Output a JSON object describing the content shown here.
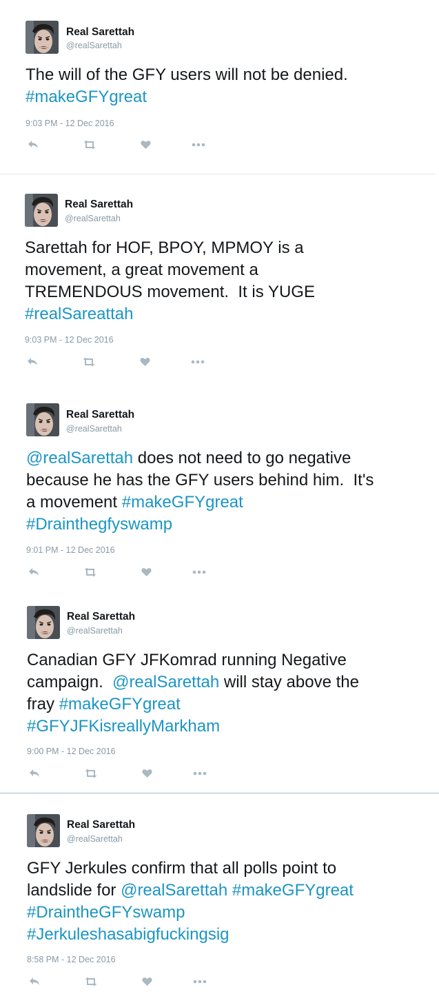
{
  "colors": {
    "link": "#1b95c4",
    "muted": "#8899a6",
    "text": "#14171a",
    "divider": "#e1e8ed"
  },
  "icons": [
    "reply-icon",
    "retweet-icon",
    "like-icon",
    "more-icon"
  ],
  "tweets": [
    {
      "name": "Real Sarettah",
      "handle": "@realSarettah",
      "lines": [
        [
          {
            "t": "The will of the GFY users will not be denied.",
            "link": false
          }
        ],
        [
          {
            "t": "#makeGFYgreat",
            "link": true
          }
        ]
      ],
      "time": "9:03 PM - 12 Dec 2016"
    },
    {
      "name": "Real Sarettah",
      "handle": "@realSarettah",
      "lines": [
        [
          {
            "t": "Sarettah for HOF, BPOY, MPMOY is a",
            "link": false
          }
        ],
        [
          {
            "t": "movement, a great movement a",
            "link": false
          }
        ],
        [
          {
            "t": "TREMENDOUS movement.  It is YUGE",
            "link": false
          }
        ],
        [
          {
            "t": "#realSareattah",
            "link": true
          }
        ]
      ],
      "time": "9:03 PM - 12 Dec 2016"
    },
    {
      "name": "Real Sarettah",
      "handle": "@realSarettah",
      "lines": [
        [
          {
            "t": "@realSarettah",
            "link": true
          },
          {
            "t": " does not need to go negative",
            "link": false
          }
        ],
        [
          {
            "t": "because he has the GFY users behind him.  It's",
            "link": false
          }
        ],
        [
          {
            "t": "a movement ",
            "link": false
          },
          {
            "t": "#makeGFYgreat",
            "link": true
          }
        ],
        [
          {
            "t": "#Drainthegfyswamp",
            "link": true
          }
        ]
      ],
      "time": "9:01 PM - 12 Dec 2016"
    },
    {
      "name": "Real Sarettah",
      "handle": "@realSarettah",
      "lines": [
        [
          {
            "t": "Canadian GFY JFKomrad running Negative",
            "link": false
          }
        ],
        [
          {
            "t": "campaign.  ",
            "link": false
          },
          {
            "t": "@realSarettah",
            "link": true
          },
          {
            "t": " will stay above the",
            "link": false
          }
        ],
        [
          {
            "t": "fray ",
            "link": false
          },
          {
            "t": "#makeGFYgreat",
            "link": true
          }
        ],
        [
          {
            "t": "#GFYJFKisreallyMarkham",
            "link": true
          }
        ]
      ],
      "time": "9:00 PM - 12 Dec 2016"
    },
    {
      "name": "Real Sarettah",
      "handle": "@realSarettah",
      "lines": [
        [
          {
            "t": "GFY Jerkules confirm that all polls point to",
            "link": false
          }
        ],
        [
          {
            "t": "landslide for ",
            "link": false
          },
          {
            "t": "@realSarettah",
            "link": true
          },
          {
            "t": " ",
            "link": false
          },
          {
            "t": "#makeGFYgreat",
            "link": true
          }
        ],
        [
          {
            "t": "#DraintheGFYswamp",
            "link": true
          }
        ],
        [
          {
            "t": "#Jerkuleshasabigfuckingsig",
            "link": true
          }
        ]
      ],
      "time": "8:58 PM - 12 Dec 2016"
    }
  ]
}
